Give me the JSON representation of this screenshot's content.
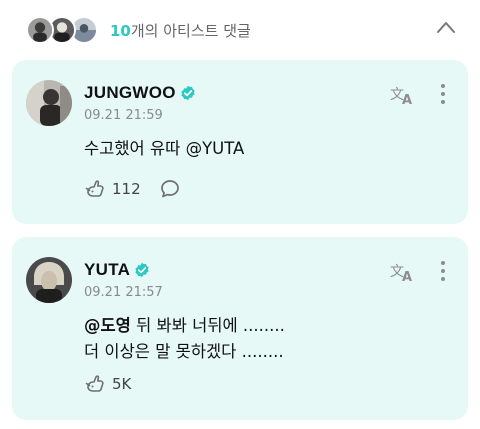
{
  "header": {
    "comment_count": "10",
    "label": "개의 아티스트 댓글"
  },
  "comments": [
    {
      "name": "JUNGWOO",
      "time": "09.21 21:59",
      "body_lines": [
        "수고했어 유따 @YUTA"
      ],
      "like_count": "112"
    },
    {
      "name": "YUTA",
      "time": "09.21 21:57",
      "mention": "@도영",
      "line1_rest": " 뒤 봐봐  너뒤에 ........",
      "line2": "더 이상은 말 못하겠다 ........",
      "like_count": "5K"
    }
  ],
  "colors": {
    "accent": "#2ac9c4",
    "card_bg": "#e7f9f7",
    "icon_gray": "#8d8d8d"
  },
  "icons": {
    "like": "bunny-paw-like-icon",
    "comment": "speech-bubble-icon",
    "translate": "translate-icon",
    "more": "more-vertical-icon",
    "verified": "verified-badge-icon",
    "collapse": "chevron-up-icon"
  }
}
